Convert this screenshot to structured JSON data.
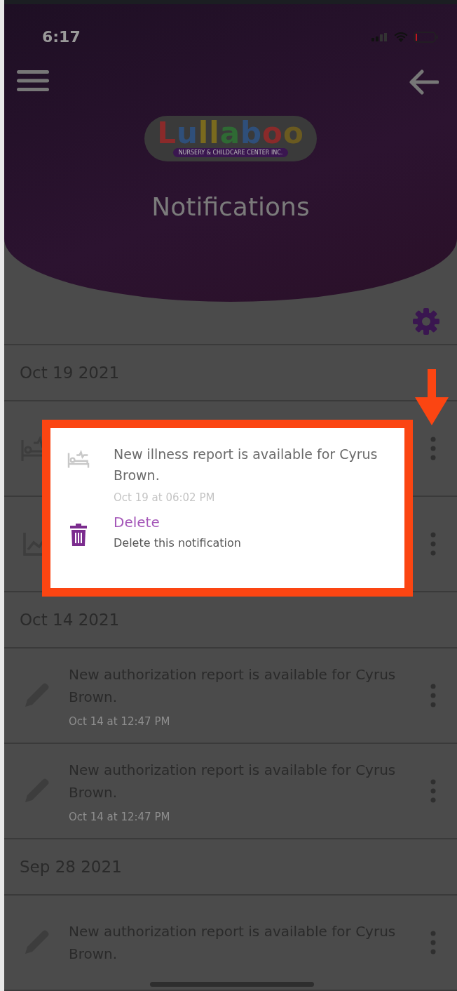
{
  "status_bar": {
    "time": "6:17"
  },
  "header": {
    "logo": {
      "wordmark": "Lullaboo",
      "tagline": "NURSERY & CHILDCARE CENTER INC."
    },
    "title": "Notifications"
  },
  "groups": [
    {
      "date": "Oct 19 2021",
      "items": [
        {
          "kind": "illness"
        },
        {
          "kind": "chart"
        }
      ]
    },
    {
      "date": "Oct 14 2021",
      "items": [
        {
          "kind": "authorization",
          "message": "New authorization report is available for Cyrus Brown.",
          "time": "Oct 14 at 12:47 PM"
        },
        {
          "kind": "authorization",
          "message": "New authorization report is available for Cyrus Brown.",
          "time": "Oct 14 at 12:47 PM"
        }
      ]
    },
    {
      "date": "Sep 28 2021",
      "items": [
        {
          "kind": "authorization",
          "message": "New authorization report is available for Cyrus Brown."
        }
      ]
    }
  ],
  "popup": {
    "kind": "illness",
    "message": "New illness report is available for Cyrus Brown.",
    "time": "Oct 19 at 06:02 PM",
    "action": {
      "label": "Delete",
      "description": "Delete this notification"
    }
  }
}
